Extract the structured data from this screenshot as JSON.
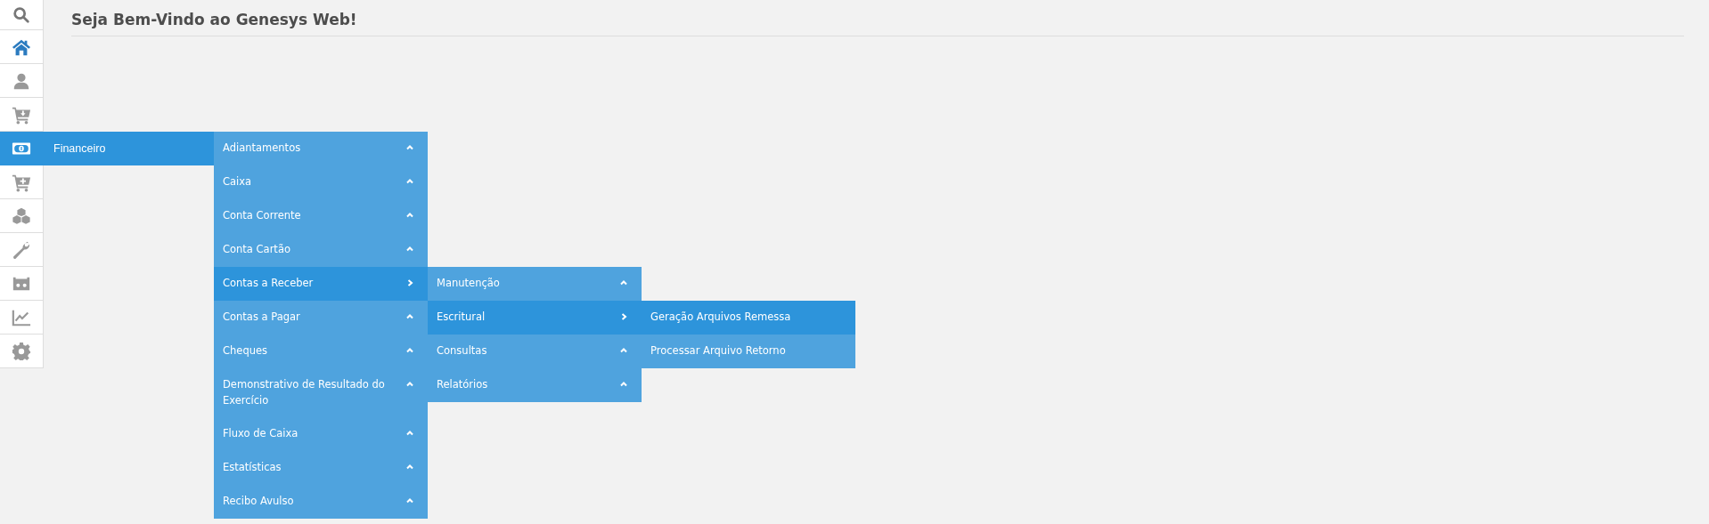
{
  "header": {
    "title": "Seja Bem-Vindo ao Genesys Web!"
  },
  "sidebar": {
    "items": [
      {
        "selected": false
      },
      {
        "selected": false
      },
      {
        "selected": false
      },
      {
        "selected": false
      },
      {
        "selected": true,
        "label": "Financeiro",
        "menu": [
          {
            "label": "Adiantamentos",
            "expanded": false
          },
          {
            "label": "Caixa",
            "expanded": false
          },
          {
            "label": "Conta Corrente",
            "expanded": false
          },
          {
            "label": "Conta Cartão",
            "expanded": false
          },
          {
            "label": "Contas a Receber",
            "expanded": true,
            "children": [
              {
                "label": "Manutenção",
                "expanded": false
              },
              {
                "label": "Escritural",
                "expanded": true,
                "children": [
                  {
                    "label": "Geração Arquivos Remessa",
                    "expanded": true
                  },
                  {
                    "label": "Processar Arquivo Retorno",
                    "expanded": false
                  }
                ]
              },
              {
                "label": "Consultas",
                "expanded": false
              },
              {
                "label": "Relatórios",
                "expanded": false
              }
            ]
          },
          {
            "label": "Contas a Pagar",
            "expanded": false
          },
          {
            "label": "Cheques",
            "expanded": false
          },
          {
            "label": "Demonstrativo de Resultado do Exercício",
            "expanded": false
          },
          {
            "label": "Fluxo de Caixa",
            "expanded": false
          },
          {
            "label": "Estatísticas",
            "expanded": false
          },
          {
            "label": "Recibo Avulso",
            "expanded": false
          }
        ]
      },
      {
        "selected": false
      },
      {
        "selected": false
      },
      {
        "selected": false
      },
      {
        "selected": false
      },
      {
        "selected": false
      },
      {
        "selected": false
      }
    ]
  }
}
